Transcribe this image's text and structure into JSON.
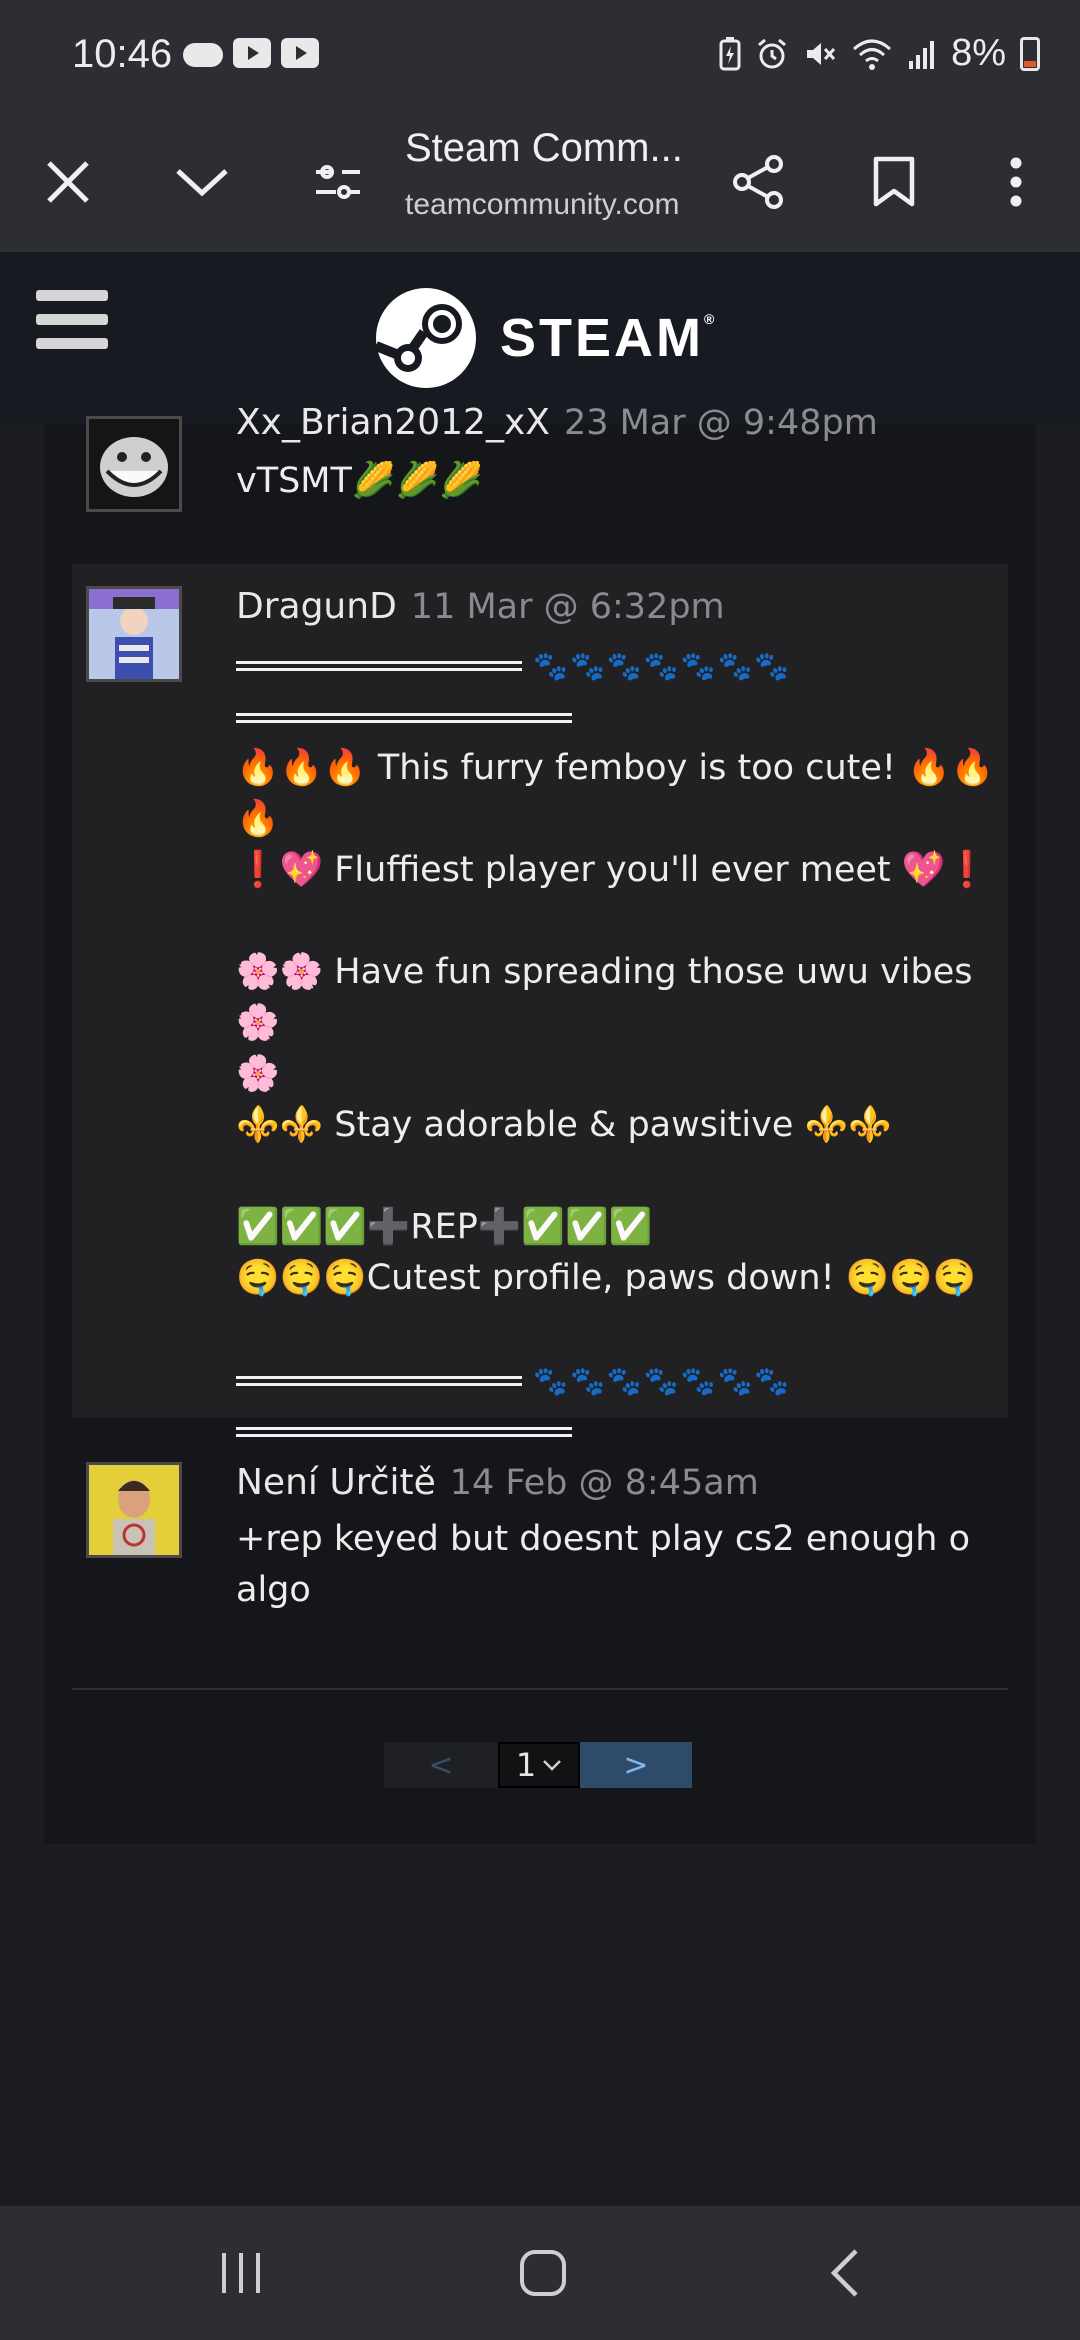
{
  "status": {
    "time": "10:46",
    "battery": "8%",
    "left_icons": [
      "cloud-icon",
      "youtube-icon",
      "youtube-icon"
    ],
    "right_icons": [
      "battery-saver-icon",
      "alarm-icon",
      "mute-icon",
      "wifi-icon",
      "signal-icon"
    ]
  },
  "browser": {
    "title": "Steam Comm...",
    "url": "teamcommunity.com"
  },
  "steam": {
    "logo_text": "STEAM"
  },
  "comments": [
    {
      "author": "Xx_Brian2012_xX",
      "time": "23 Mar @ 9:48pm",
      "text": "vTSMT🌽🌽🌽"
    },
    {
      "author": "DragunD",
      "time": "11 Mar @ 6:32pm",
      "paws": "🐾🐾🐾🐾🐾🐾🐾",
      "line1": "🔥🔥🔥 This furry femboy is too cute! 🔥🔥",
      "line1b": "🔥",
      "line2": "❗💖 Fluffiest player you'll ever meet 💖❗",
      "line3": "🌸🌸 Have fun spreading those uwu vibes 🌸",
      "line3b": "🌸",
      "line4": "⚜️⚜️ Stay adorable & pawsitive ⚜️⚜️",
      "line5": "✅✅✅➕REP➕✅✅✅",
      "line6": "🤤🤤🤤Cutest profile, paws down! 🤤🤤🤤",
      "paws2": "🐾🐾🐾🐾🐾🐾🐾"
    },
    {
      "author": "Není Určitě",
      "time": "14 Feb @ 8:45am",
      "text": "+rep keyed but doesnt play cs2 enough o algo"
    }
  ],
  "pager": {
    "prev": "<",
    "current": "1",
    "next": ">"
  }
}
